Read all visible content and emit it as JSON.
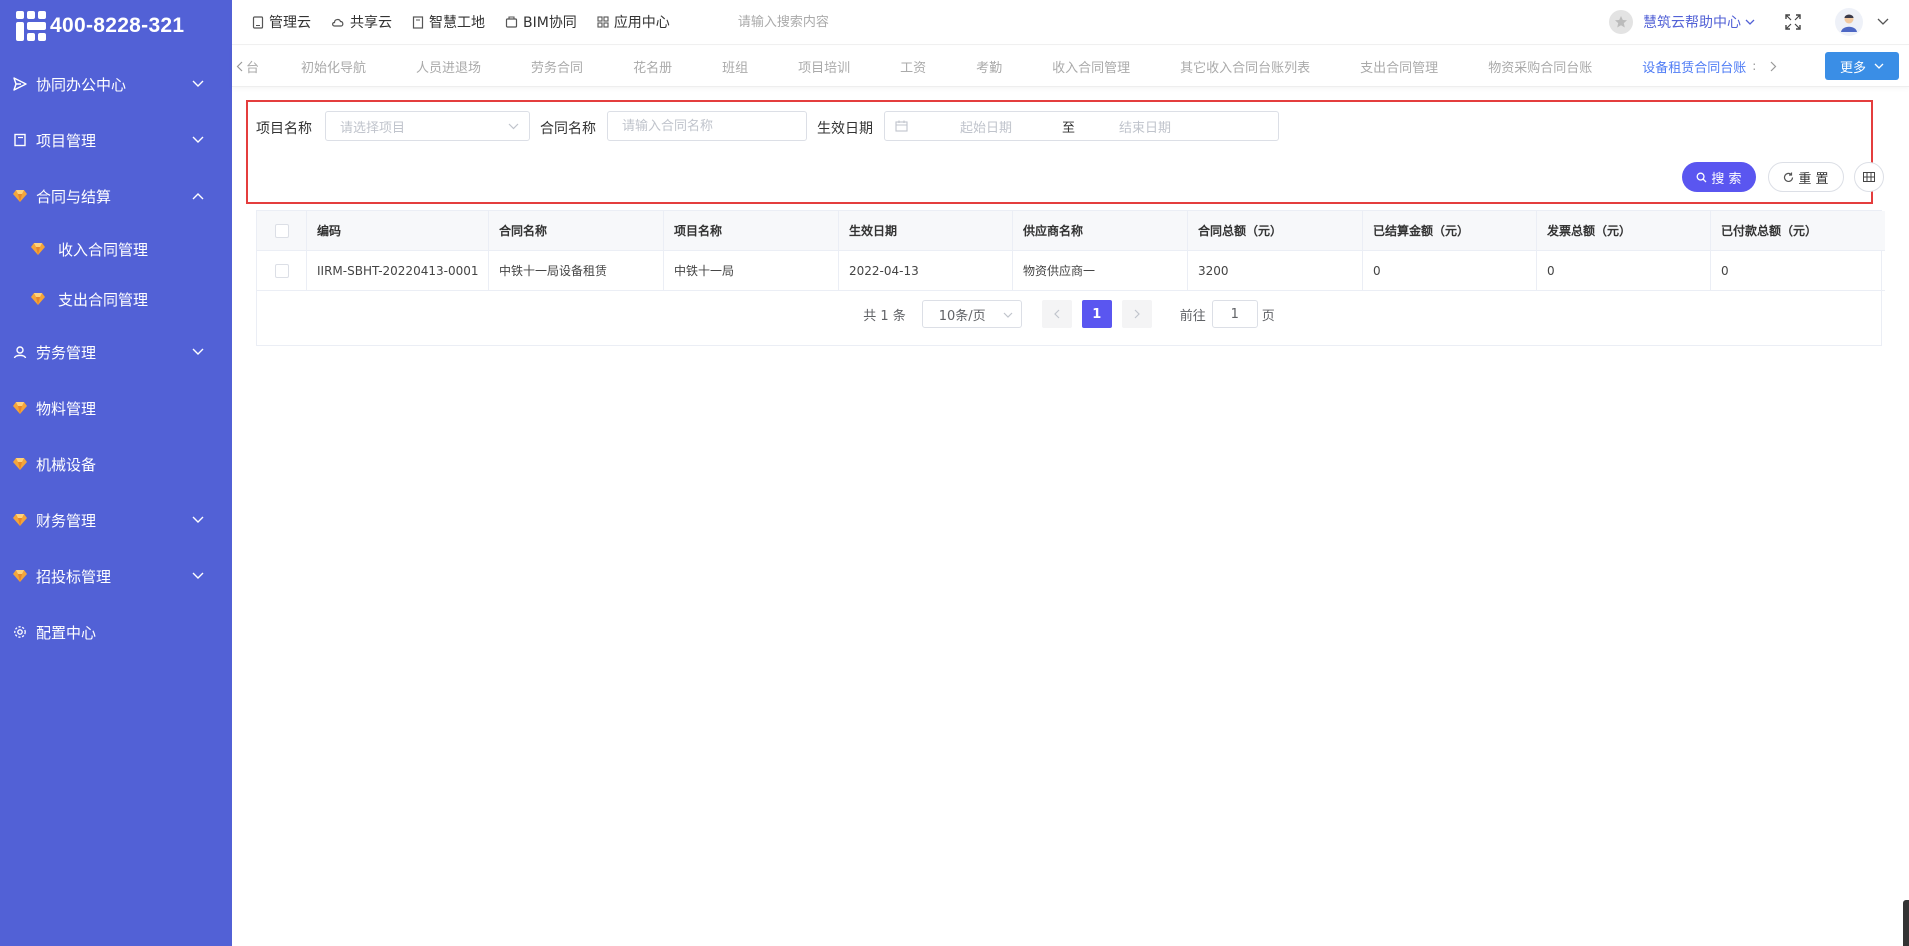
{
  "brand": {
    "phone": "400-8228-321"
  },
  "sidebar": {
    "items": [
      {
        "label": "协同办公中心",
        "icon": "send-icon",
        "arrow": "down"
      },
      {
        "label": "项目管理",
        "icon": "book-icon",
        "arrow": "down"
      },
      {
        "label": "合同与结算",
        "icon": "gem-icon",
        "arrow": "up"
      },
      {
        "label": "劳务管理",
        "icon": "user-icon",
        "arrow": "down"
      },
      {
        "label": "物料管理",
        "icon": "gem-icon",
        "arrow": ""
      },
      {
        "label": "机械设备",
        "icon": "gem-icon",
        "arrow": ""
      },
      {
        "label": "财务管理",
        "icon": "gem-icon",
        "arrow": "down"
      },
      {
        "label": "招投标管理",
        "icon": "gem-icon",
        "arrow": "down"
      },
      {
        "label": "配置中心",
        "icon": "gear-icon",
        "arrow": ""
      }
    ],
    "subitems": [
      {
        "label": "收入合同管理",
        "icon": "gem-icon"
      },
      {
        "label": "支出合同管理",
        "icon": "gem-icon"
      }
    ]
  },
  "topnav": {
    "items": [
      {
        "label": "管理云",
        "icon": "tablet-icon"
      },
      {
        "label": "共享云",
        "icon": "cloud-icon"
      },
      {
        "label": "智慧工地",
        "icon": "book-icon"
      },
      {
        "label": "BIM协同",
        "icon": "box-icon"
      },
      {
        "label": "应用中心",
        "icon": "grid-icon"
      }
    ],
    "search_placeholder": "请输入搜索内容",
    "help_label": "慧筑云帮助中心"
  },
  "tabs": {
    "items": [
      "台",
      "初始化导航",
      "人员进退场",
      "劳务合同",
      "花名册",
      "班组",
      "项目培训",
      "工资",
      "考勤",
      "收入合同管理",
      "其它收入合同台账列表",
      "支出合同管理",
      "物资采购合同台账",
      "设备租赁合同台账"
    ],
    "active_index": 13,
    "more_label": "更多"
  },
  "filter": {
    "project_label": "项目名称",
    "project_placeholder": "请选择项目",
    "contract_label": "合同名称",
    "contract_placeholder": "请输入合同名称",
    "date_label": "生效日期",
    "start_placeholder": "起始日期",
    "date_sep": "至",
    "end_placeholder": "结束日期",
    "search_label": "搜 索",
    "reset_label": "重 置"
  },
  "table": {
    "columns": [
      "编码",
      "合同名称",
      "项目名称",
      "生效日期",
      "供应商名称",
      "合同总额（元）",
      "已结算金额（元）",
      "发票总额（元）",
      "已付款总额（元）"
    ],
    "rows": [
      [
        "IIRM-SBHT-20220413-0001",
        "中铁十一局设备租赁",
        "中铁十一局",
        "2022-04-13",
        "物资供应商一",
        "3200",
        "0",
        "0",
        "0"
      ]
    ]
  },
  "pager": {
    "total": "共 1 条",
    "page_size": "10条/页",
    "current": "1",
    "goto_label": "前往",
    "goto_value": "1",
    "page_suffix": "页"
  },
  "colors": {
    "sidebar_bg": "#5261d6",
    "primary": "#5a56f0",
    "more_button": "#3a8ee6",
    "highlight_border": "#e43d3d",
    "active_tab": "#4f7cf5"
  }
}
